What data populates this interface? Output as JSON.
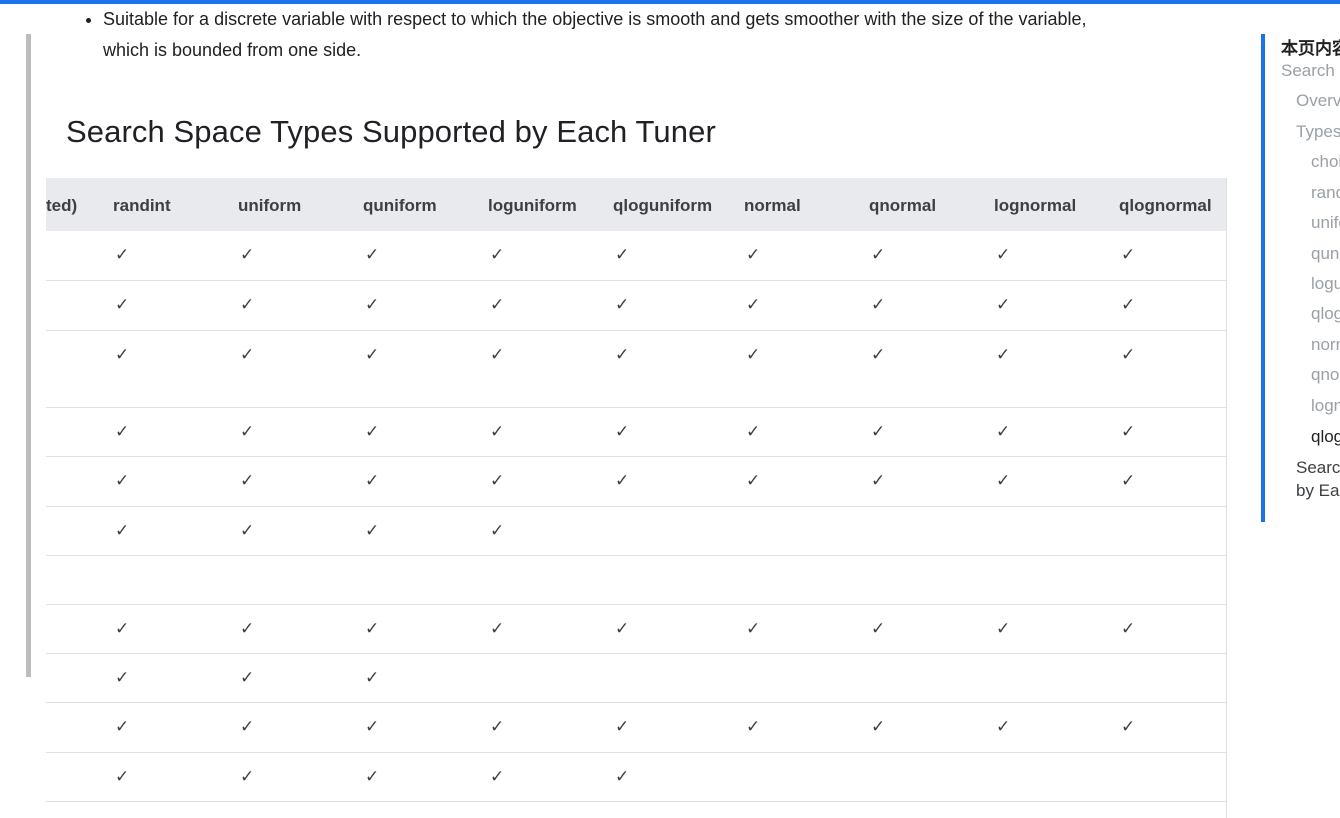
{
  "intro": {
    "bullet_line1": "Suitable for a discrete variable with respect to which the objective is smooth and gets smoother with the size of the variable,",
    "bullet_line2": "which is bounded from one side."
  },
  "section": {
    "heading": "Search Space Types Supported by Each Tuner"
  },
  "table": {
    "columns": [
      "ted)",
      "randint",
      "uniform",
      "quniform",
      "loguniform",
      "qloguniform",
      "normal",
      "qnormal",
      "lognormal",
      "qlognormal"
    ],
    "check_mark": "✓",
    "rows": [
      {
        "checks": [
          1,
          1,
          1,
          1,
          1,
          1,
          1,
          1,
          1
        ]
      },
      {
        "checks": [
          1,
          1,
          1,
          1,
          1,
          1,
          1,
          1,
          1
        ]
      },
      {
        "checks": [
          1,
          1,
          1,
          1,
          1,
          1,
          1,
          1,
          1
        ]
      },
      {
        "checks": [
          1,
          1,
          1,
          1,
          1,
          1,
          1,
          1,
          1
        ]
      },
      {
        "checks": [
          1,
          1,
          1,
          1,
          1,
          1,
          1,
          1,
          1
        ]
      },
      {
        "checks": [
          1,
          1,
          1,
          1,
          0,
          0,
          0,
          0,
          0
        ]
      },
      {
        "checks": [
          0,
          0,
          0,
          0,
          0,
          0,
          0,
          0,
          0
        ]
      },
      {
        "checks": [
          1,
          1,
          1,
          1,
          1,
          1,
          1,
          1,
          1
        ]
      },
      {
        "checks": [
          1,
          1,
          1,
          0,
          0,
          0,
          0,
          0,
          0
        ]
      },
      {
        "checks": [
          1,
          1,
          1,
          1,
          1,
          1,
          1,
          1,
          1
        ]
      },
      {
        "checks": [
          1,
          1,
          1,
          1,
          1,
          0,
          0,
          0,
          0
        ]
      }
    ]
  },
  "toc": {
    "title": "本页内容",
    "items": [
      {
        "label": "Search Space",
        "level": 0,
        "active": false
      },
      {
        "label": "Overview",
        "level": 1,
        "active": false
      },
      {
        "label": "Types",
        "level": 1,
        "active": false
      },
      {
        "label": "choice",
        "level": 2,
        "active": false
      },
      {
        "label": "randint",
        "level": 2,
        "active": false
      },
      {
        "label": "uniform",
        "level": 2,
        "active": false
      },
      {
        "label": "quniform",
        "level": 2,
        "active": false
      },
      {
        "label": "loguniform",
        "level": 2,
        "active": false
      },
      {
        "label": "qloguniform",
        "level": 2,
        "active": false
      },
      {
        "label": "normal",
        "level": 2,
        "active": false
      },
      {
        "label": "qnormal",
        "level": 2,
        "active": false
      },
      {
        "label": "lognormal",
        "level": 2,
        "active": false
      },
      {
        "label": "qlognormal",
        "level": 2,
        "active": true
      },
      {
        "label": "Search Space Types Supported",
        "level": 1,
        "active": false
      },
      {
        "label": "by Each Tuner",
        "level": 1,
        "active": false
      }
    ]
  }
}
